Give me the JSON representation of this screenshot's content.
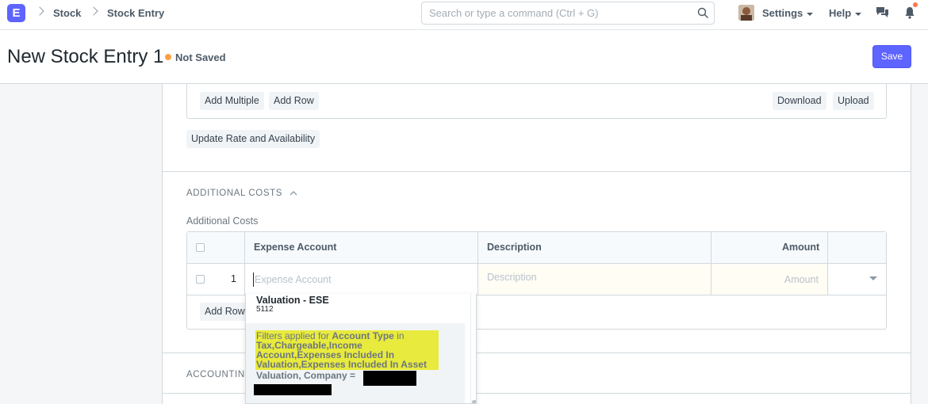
{
  "navbar": {
    "logo_letter": "E",
    "breadcrumbs": [
      "Stock",
      "Stock Entry"
    ],
    "search_placeholder": "Search or type a command (Ctrl + G)",
    "settings_label": "Settings",
    "help_label": "Help"
  },
  "header": {
    "title": "New Stock Entry 1",
    "status": "Not Saved",
    "save_label": "Save"
  },
  "items_section": {
    "add_multiple": "Add Multiple",
    "add_row": "Add Row",
    "download": "Download",
    "upload": "Upload",
    "update_rate": "Update Rate and Availability"
  },
  "additional_costs": {
    "section_title": "ADDITIONAL COSTS",
    "field_label": "Additional Costs",
    "columns": [
      "Expense Account",
      "Description",
      "Amount"
    ],
    "row_index": "1",
    "expense_placeholder": "Expense Account",
    "description_placeholder": "Description",
    "amount_placeholder": "Amount",
    "add_row": "Add Row"
  },
  "accounting_section": {
    "title": "ACCOUNTING"
  },
  "dropdown": {
    "option_title": "Valuation - ESE",
    "option_code": "5112",
    "filter_prefix": "Filters applied for ",
    "filter_field": "Account Type",
    "filter_in": " in ",
    "filter_values": "Tax,Chargeable,Income Account,Expenses Included In Valuation,Expenses Included In Asset",
    "filter_second": "Valuation, Company ="
  },
  "colors": {
    "accent": "#5e64ff",
    "status_dot": "#ff9f43",
    "notification_dot": "#ff7846",
    "highlight": "#e8ea3d"
  }
}
